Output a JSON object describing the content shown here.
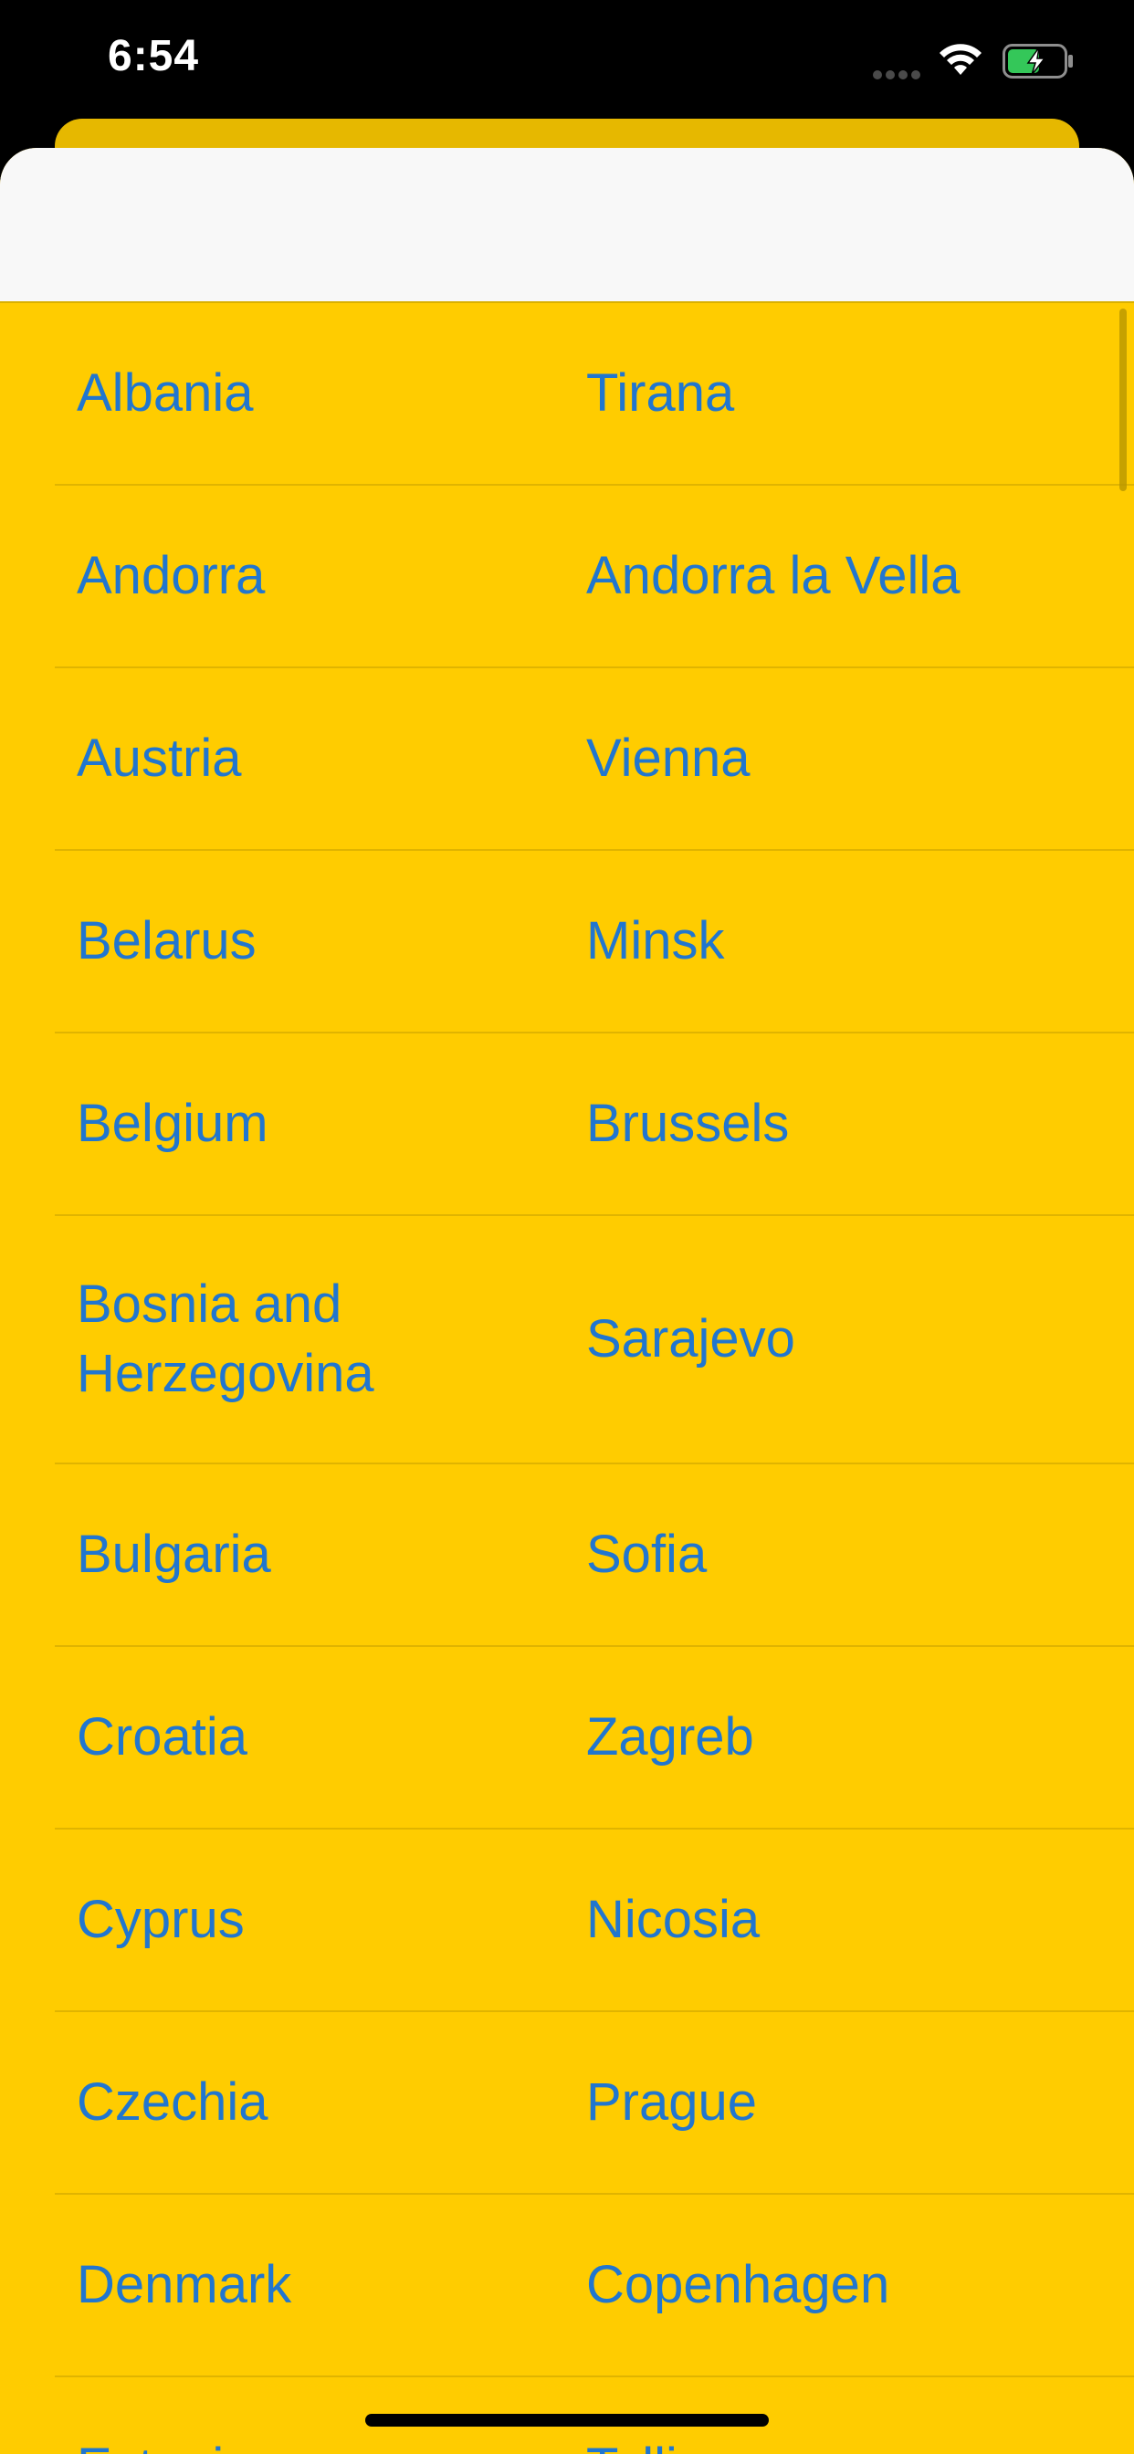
{
  "status_bar": {
    "time": "6:54"
  },
  "icons": {
    "wifi": "wifi-icon",
    "battery": "battery-charging-icon",
    "signal": "cellular-signal-dots"
  },
  "colors": {
    "list_background": "#ffcc00",
    "text": "#2176cf",
    "header_background": "#f8f8f8",
    "battery_fill": "#34c759"
  },
  "battery": {
    "level": 0.55,
    "charging": true
  },
  "countries": [
    {
      "country": "Albania",
      "capital": "Tirana"
    },
    {
      "country": "Andorra",
      "capital": "Andorra la Vella"
    },
    {
      "country": "Austria",
      "capital": "Vienna"
    },
    {
      "country": "Belarus",
      "capital": "Minsk"
    },
    {
      "country": "Belgium",
      "capital": "Brussels"
    },
    {
      "country": "Bosnia and Herzegovina",
      "capital": "Sarajevo"
    },
    {
      "country": "Bulgaria",
      "capital": "Sofia"
    },
    {
      "country": "Croatia",
      "capital": "Zagreb"
    },
    {
      "country": "Cyprus",
      "capital": "Nicosia"
    },
    {
      "country": "Czechia",
      "capital": "Prague"
    },
    {
      "country": "Denmark",
      "capital": "Copenhagen"
    },
    {
      "country": "Estonia",
      "capital": "Tallinn"
    }
  ]
}
